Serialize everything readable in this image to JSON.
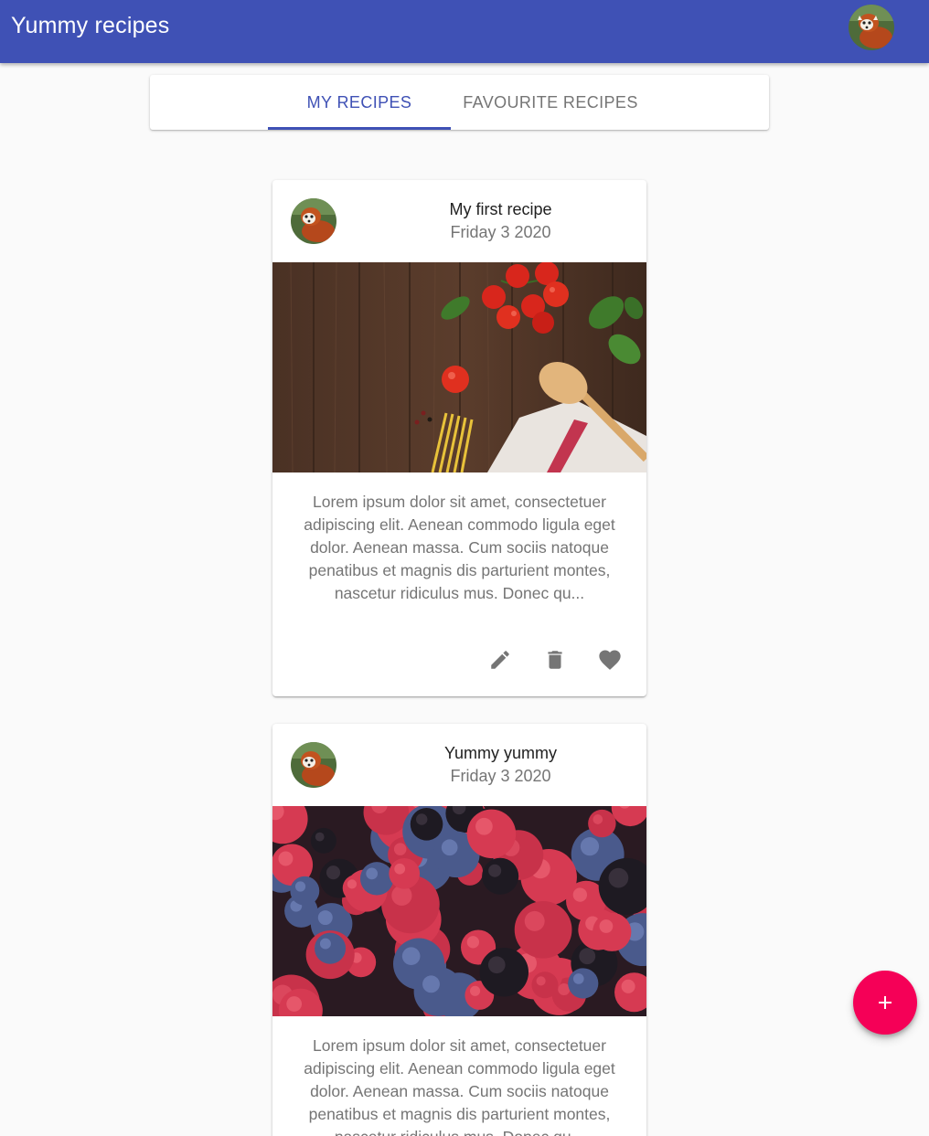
{
  "appbar": {
    "title": "Yummy recipes",
    "color": "#3f51b5"
  },
  "tabs": [
    {
      "label": "MY RECIPES",
      "selected": true
    },
    {
      "label": "FAVOURITE RECIPES",
      "selected": false
    }
  ],
  "recipes": [
    {
      "title": "My first recipe",
      "date": "Friday 3 2020",
      "image": "wooden-table-tomatoes-basil-spaghetti-spoon",
      "description": "Lorem ipsum dolor sit amet, consectetuer adipiscing elit. Aenean commodo ligula eget dolor. Aenean massa. Cum sociis natoque penatibus et magnis dis parturient montes, nascetur ridiculus mus. Donec qu..."
    },
    {
      "title": "Yummy yummy",
      "date": "Friday 3 2020",
      "image": "raspberries-blueberries-blackberries",
      "description": "Lorem ipsum dolor sit amet, consectetuer adipiscing elit. Aenean commodo ligula eget dolor. Aenean massa. Cum sociis natoque penatibus et magnis dis parturient montes, nascetur ridiculus mus. Donec qu..."
    }
  ],
  "icons": {
    "edit": "pencil-icon",
    "delete": "trash-icon",
    "favourite": "heart-icon",
    "add": "plus-icon"
  },
  "colors": {
    "primary": "#3f51b5",
    "accent": "#f50057"
  }
}
